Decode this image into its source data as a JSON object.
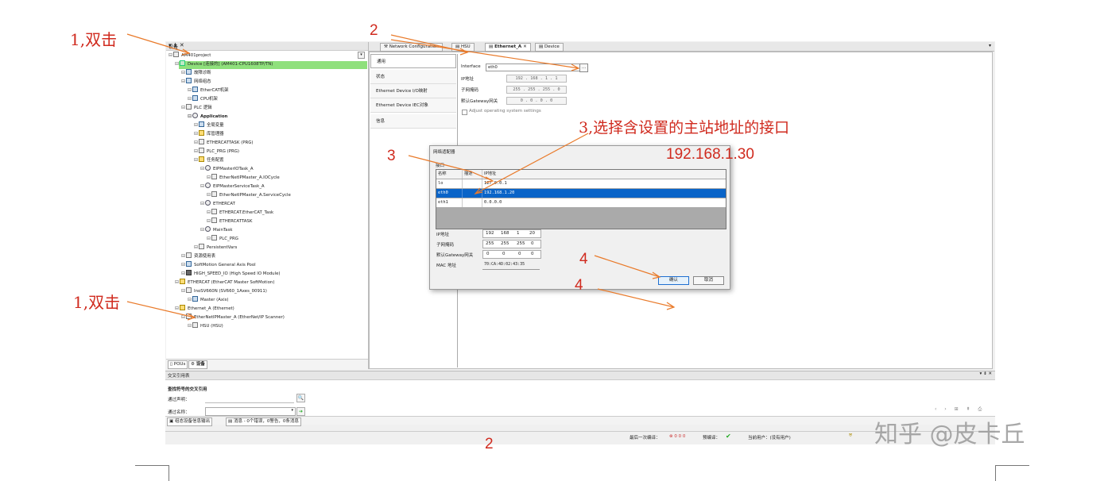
{
  "tree_panel": {
    "title": "设备",
    "window_controls": "▾ ⇟ ✕",
    "nodes": [
      {
        "label": "AM401project",
        "depth": 0,
        "icon": "project-icon"
      },
      {
        "label": "Device [连接的] (AM401-CPU1608TP/TN)",
        "depth": 1,
        "icon": "device-icon",
        "selected": true
      },
      {
        "label": "故障诊断",
        "depth": 2,
        "icon": "diagnosis-icon"
      },
      {
        "label": "网络组态",
        "depth": 2,
        "icon": "network-config-icon"
      },
      {
        "label": "EtherCAT机架",
        "depth": 3,
        "icon": "ethercat-rack-icon"
      },
      {
        "label": "CPU机架",
        "depth": 3,
        "icon": "cpu-rack-icon"
      },
      {
        "label": "PLC 逻辑",
        "depth": 2,
        "icon": "plc-logic-icon"
      },
      {
        "label": "Application",
        "depth": 3,
        "icon": "application-icon",
        "bold": true
      },
      {
        "label": "全局变量",
        "depth": 4,
        "icon": "global-vars-icon"
      },
      {
        "label": "库管理器",
        "depth": 4,
        "icon": "library-icon"
      },
      {
        "label": "ETHERCATTASK (PRG)",
        "depth": 4,
        "icon": "program-icon"
      },
      {
        "label": "PLC_PRG (PRG)",
        "depth": 4,
        "icon": "program-icon"
      },
      {
        "label": "任务配置",
        "depth": 4,
        "icon": "task-config-icon"
      },
      {
        "label": "EIPMasterIOTask_A",
        "depth": 5,
        "icon": "task-icon"
      },
      {
        "label": "EtherNetIPMaster_A.IOCycle",
        "depth": 6,
        "icon": "call-icon"
      },
      {
        "label": "EIPMasterServiceTask_A",
        "depth": 5,
        "icon": "task-icon"
      },
      {
        "label": "EtherNetIPMaster_A.ServiceCycle",
        "depth": 6,
        "icon": "call-icon"
      },
      {
        "label": "ETHERCAT",
        "depth": 5,
        "icon": "task-icon"
      },
      {
        "label": "ETHERCAT.EtherCAT_Task",
        "depth": 6,
        "icon": "call-icon"
      },
      {
        "label": "ETHERCATTASK",
        "depth": 6,
        "icon": "call-icon"
      },
      {
        "label": "MainTask",
        "depth": 5,
        "icon": "task-icon"
      },
      {
        "label": "PLC_PRG",
        "depth": 6,
        "icon": "call-icon"
      },
      {
        "label": "PersistentVars",
        "depth": 4,
        "icon": "persistent-vars-icon"
      },
      {
        "label": "资源使用表",
        "depth": 2,
        "icon": "resource-icon"
      },
      {
        "label": "SoftMotion General Axis Pool",
        "depth": 2,
        "icon": "axis-pool-icon"
      },
      {
        "label": "HIGH_SPEED_IO (High Speed IO Module)",
        "depth": 2,
        "icon": "io-module-icon"
      },
      {
        "label": "ETHERCAT (EtherCAT Master SoftMotion)",
        "depth": 1,
        "icon": "ethercat-master-icon"
      },
      {
        "label": "InoSV660N (SV660_1Axes_00911)",
        "depth": 2,
        "icon": "servo-icon"
      },
      {
        "label": "Master (Axis)",
        "depth": 3,
        "icon": "axis-icon"
      },
      {
        "label": "Ethernet_A (Ethernet)",
        "depth": 1,
        "icon": "ethernet-icon"
      },
      {
        "label": "EtherNetIPMaster_A (EtherNet/IP Scanner)",
        "depth": 2,
        "icon": "scanner-icon"
      },
      {
        "label": "HSU (HSU)",
        "depth": 3,
        "icon": "hsu-icon"
      }
    ],
    "bottom_tabs": [
      "POUs",
      "设备"
    ]
  },
  "editor": {
    "tabs": [
      "Network Configuration",
      "HSU",
      "Ethernet_A",
      "Device"
    ],
    "active_tab": "Ethernet_A",
    "side_tabs": [
      "通用",
      "状态",
      "Ethernet Device I/O映射",
      "Ethernet Device IEC对象",
      "信息"
    ],
    "interface_label": "Interface",
    "interface_value": "eth0",
    "browse_label": "...",
    "ip_label": "IP地址",
    "ip_value": "192 . 168 . 1 . 1",
    "subnet_label": "子网掩码",
    "subnet_value": "255 . 255 . 255 . 0",
    "gateway_label": "默认Gateway网关",
    "gateway_value": "0 . 0 . 0 . 0",
    "adjust_label": "Adjust operating system settings"
  },
  "dialog": {
    "title": "网络适配器",
    "group_label": "接口",
    "columns": [
      "名称",
      "描述",
      "IP地址"
    ],
    "rows": [
      {
        "name": "lo",
        "desc": "",
        "ip": "127.0.0.1"
      },
      {
        "name": "eth0",
        "desc": "",
        "ip": "192.168.1.20",
        "selected": true
      },
      {
        "name": "eth1",
        "desc": "",
        "ip": "0.0.0.0"
      }
    ],
    "ip_label": "IP地址",
    "ip_parts": [
      "192",
      "168",
      "1",
      "20"
    ],
    "subnet_label": "子网掩码",
    "subnet_parts": [
      "255",
      "255",
      "255",
      "0"
    ],
    "gateway_label": "默认Gateway网关",
    "gateway_parts": [
      "0",
      "0",
      "0",
      "0"
    ],
    "mac_label": "MAC 地址",
    "mac_value": "70:CA:4D:02:43:35",
    "ok_label": "确认",
    "cancel_label": "取消"
  },
  "bottom_panel": {
    "title": "交叉引用表",
    "controls": "▾ ⇟ ✕",
    "heading": "查找符号的交叉引用",
    "by_declaration_label": "通过声明：",
    "by_name_label": "通过名称：",
    "tabs": [
      "组态设备信息输出",
      "消息 - 0个错误，0警告，0条消息"
    ]
  },
  "status_bar": {
    "last_compile_label": "最后一次编译：",
    "compile_counts": "0 0 0",
    "precompile_label": "预编译：",
    "current_user_label": "当前用户：(没有用户)"
  },
  "annotations": {
    "step1_top": "1,双击",
    "step1_bottom": "1,双击",
    "step2_top": "2",
    "step2_bottom": "2",
    "step3_instruction": "3,选择含设置的主站地址的接口",
    "step3": "3",
    "master_ip": "192.168.1.30",
    "step4_a": "4",
    "step4_b": "4"
  },
  "watermark": "知乎 @皮卡丘",
  "colors": {
    "annotation": "#d02b1f",
    "selection_green": "#8fe07c",
    "selection_blue": "#0a64c8"
  }
}
